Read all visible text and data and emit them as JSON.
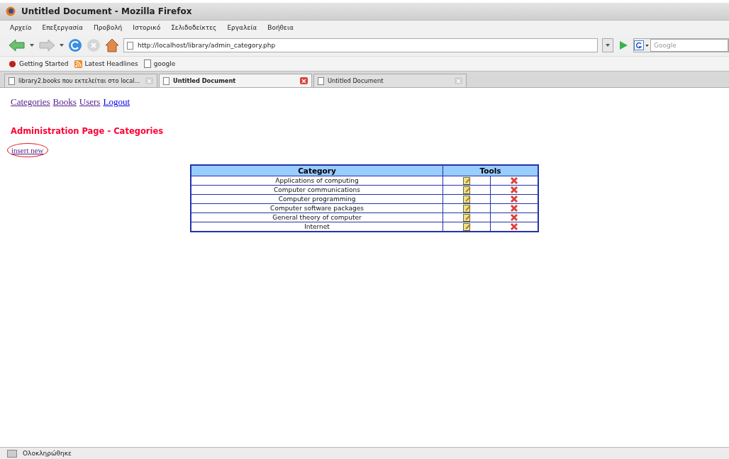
{
  "window": {
    "title": "Untitled Document - Mozilla Firefox"
  },
  "menu": [
    "Αρχείο",
    "Επεξεργασία",
    "Προβολή",
    "Ιστορικό",
    "Σελιδοδείκτες",
    "Εργαλεία",
    "Βοήθεια"
  ],
  "address": {
    "value": "http://localhost/library/admin_category.php"
  },
  "search": {
    "placeholder": "Google"
  },
  "bookmarks": [
    {
      "label": "Getting Started",
      "kind": "firefox"
    },
    {
      "label": "Latest Headlines",
      "kind": "feed"
    },
    {
      "label": "google",
      "kind": "page"
    }
  ],
  "tabs": [
    {
      "label": "library2.books που εκτελείται στο local...",
      "selected": false
    },
    {
      "label": "Untitled Document",
      "selected": true
    },
    {
      "label": "Untitled Document",
      "selected": false
    }
  ],
  "nav_links": [
    {
      "label": "Categories",
      "visited": true
    },
    {
      "label": "Books",
      "visited": true
    },
    {
      "label": "Users",
      "visited": true
    },
    {
      "label": "Logout",
      "visited": false
    }
  ],
  "heading": "Administration Page - Categories",
  "insert_link": {
    "label": "insert new",
    "circled": true
  },
  "table": {
    "columns": [
      "Category",
      "Tools"
    ],
    "rows": [
      "Applications of computing",
      "Computer communications",
      "Computer programming",
      "Computer software packages",
      "General theory of computer",
      "Internet"
    ]
  },
  "status_bar": "Ολοκληρώθηκε"
}
